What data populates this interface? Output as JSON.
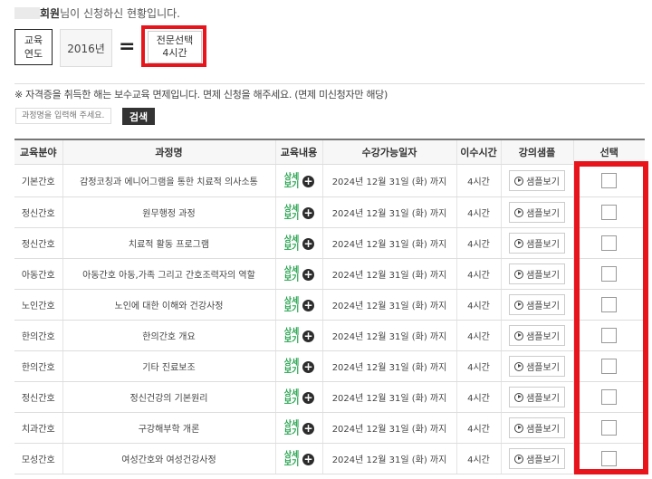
{
  "header": {
    "greeting_name": "회원",
    "greeting_rest": "님이 신청하신 현황입니다.",
    "year_label": "교육\n연도",
    "year_value": "2016년",
    "equals": "=",
    "selection_line1": "전문선택",
    "selection_line2": "4시간"
  },
  "notice": "※ 자격증을 취득한 해는 보수교육 면제입니다. 면제 신청을 해주세요. (면제 미신청자만 해당)",
  "search": {
    "placeholder": "과정명을 입력해 주세요.",
    "button_label": "검색"
  },
  "table": {
    "headers": [
      "교육분야",
      "과정명",
      "교육내용",
      "수강가능일자",
      "이수시간",
      "강의샘플",
      "선택"
    ],
    "detail_label": "상세\n보기",
    "sample_label": "샘플보기",
    "rows": [
      {
        "field": "기본간호",
        "course": "감정코칭과 에니어그램을 통한 치료적 의사소통",
        "date": "2024년 12월 31일 (화) 까지",
        "hours": "4시간"
      },
      {
        "field": "정신간호",
        "course": "원무행정 과정",
        "date": "2024년 12월 31일 (화) 까지",
        "hours": "4시간"
      },
      {
        "field": "정신간호",
        "course": "치료적 활동 프로그램",
        "date": "2024년 12월 31일 (화) 까지",
        "hours": "4시간"
      },
      {
        "field": "아동간호",
        "course": "아동간호 아동,가족 그리고 간호조력자의 역할",
        "date": "2024년 12월 31일 (화) 까지",
        "hours": "4시간"
      },
      {
        "field": "노인간호",
        "course": "노인에 대한 이해와 건강사정",
        "date": "2024년 12월 31일 (화) 까지",
        "hours": "4시간"
      },
      {
        "field": "한의간호",
        "course": "한의간호 개요",
        "date": "2024년 12월 31일 (화) 까지",
        "hours": "4시간"
      },
      {
        "field": "한의간호",
        "course": "기타 진료보조",
        "date": "2024년 12월 31일 (화) 까지",
        "hours": "4시간"
      },
      {
        "field": "정신간호",
        "course": "정신건강의 기본원리",
        "date": "2024년 12월 31일 (화) 까지",
        "hours": "4시간"
      },
      {
        "field": "치과간호",
        "course": "구강해부학 개론",
        "date": "2024년 12월 31일 (화) 까지",
        "hours": "4시간"
      },
      {
        "field": "모성간호",
        "course": "여성간호와 여성건강사정",
        "date": "2024년 12월 31일 (화) 까지",
        "hours": "4시간"
      }
    ]
  },
  "colors": {
    "highlight": "#e8141b",
    "detail_text": "#22a14b",
    "search_button": "#333333"
  }
}
